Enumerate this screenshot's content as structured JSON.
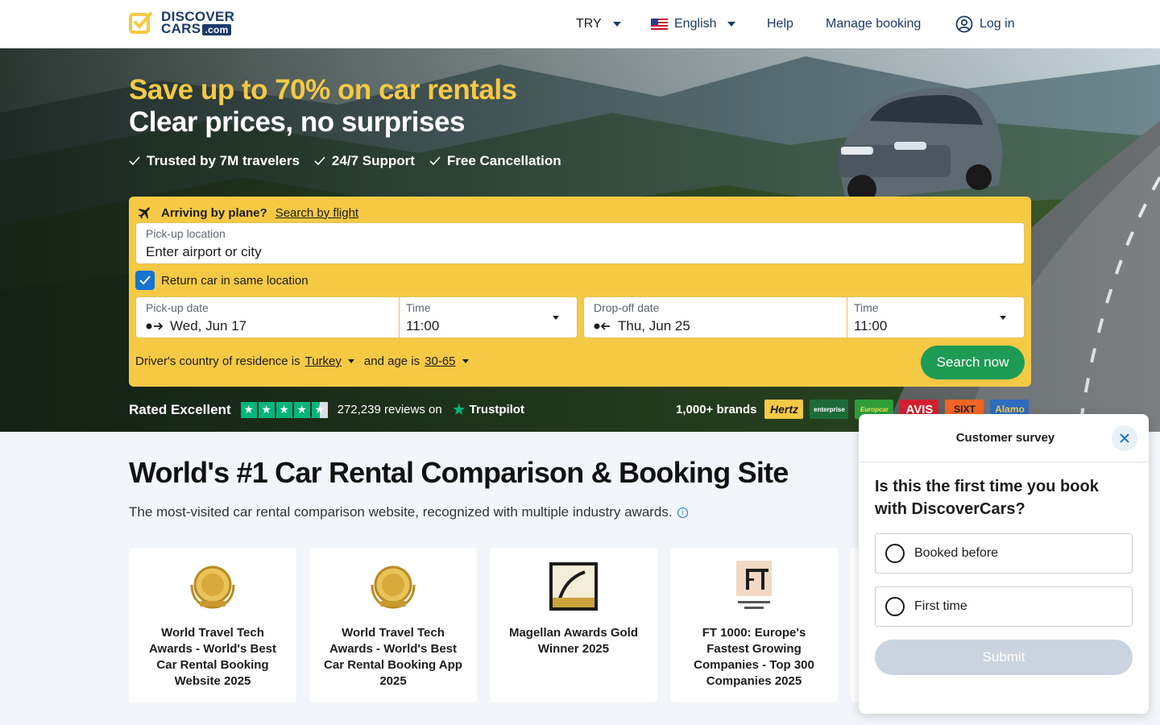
{
  "header": {
    "logo_line1": "DISCOVER",
    "logo_line2": "CARS",
    "logo_com": ".com",
    "currency": "TRY",
    "language": "English",
    "help": "Help",
    "manage_booking": "Manage booking",
    "login": "Log in"
  },
  "hero": {
    "title_line1": "Save up to 70% on car rentals",
    "title_line2": "Clear prices, no surprises",
    "badges": [
      "Trusted by 7M travelers",
      "24/7 Support",
      "Free Cancellation"
    ]
  },
  "search": {
    "flight_prompt": "Arriving by plane?",
    "flight_link": "Search by flight",
    "pickup_location_label": "Pick-up location",
    "pickup_location_placeholder": "Enter airport or city",
    "same_location_label": "Return car in same location",
    "same_location_checked": true,
    "pickup_date_label": "Pick-up date",
    "pickup_date": "Wed, Jun 17",
    "pickup_time_label": "Time",
    "pickup_time": "11:00",
    "dropoff_date_label": "Drop-off date",
    "dropoff_date": "Thu, Jun 25",
    "dropoff_time_label": "Time",
    "dropoff_time": "11:00",
    "residence_prefix": "Driver's country of residence is",
    "residence_country": "Turkey",
    "age_prefix": "and age is",
    "age_range": "30-65",
    "search_button": "Search now"
  },
  "rating": {
    "label": "Rated Excellent",
    "reviews": "272,239 reviews on",
    "provider": "Trustpilot",
    "stars": 4.5
  },
  "brands": {
    "label": "1,000+ brands",
    "items": [
      "Hertz",
      "enterprise",
      "Europcar",
      "AVIS",
      "SIXT",
      "Alamo"
    ]
  },
  "main": {
    "heading": "World's #1 Car Rental Comparison & Booking Site",
    "subheading": "The most-visited car rental comparison website, recognized with multiple industry awards.",
    "awards": [
      {
        "icon": "laurel-award-icon",
        "text": "World Travel Tech Awards - World's Best Car Rental Booking Website 2025"
      },
      {
        "icon": "laurel-award-icon",
        "text": "World Travel Tech Awards - World's Best Car Rental Booking App 2025"
      },
      {
        "icon": "magellan-award-icon",
        "text": "Magellan Awards Gold Winner 2025"
      },
      {
        "icon": "ft-logo-icon",
        "text": "FT 1000: Europe's Fastest Growing Companies - Top 300 Companies 2025"
      }
    ]
  },
  "survey": {
    "title": "Customer survey",
    "question": "Is this the first time you book with DiscoverCars?",
    "options": [
      "Booked before",
      "First time"
    ],
    "submit": "Submit"
  }
}
